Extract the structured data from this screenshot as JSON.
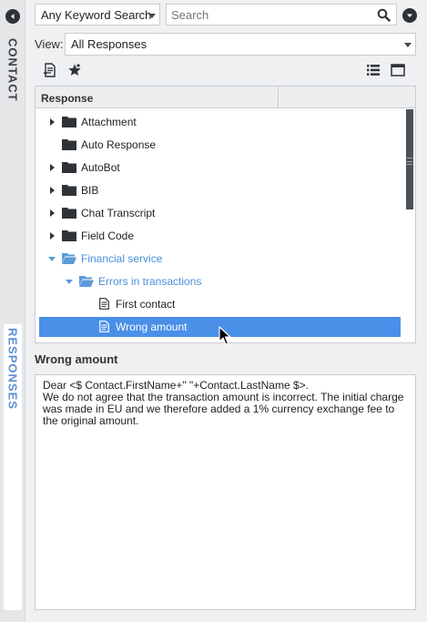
{
  "sidebar": {
    "contact_tab": "CONTACT",
    "responses_tab": "RESPONSES"
  },
  "search": {
    "mode_label": "Any Keyword Search",
    "placeholder": "Search",
    "value": ""
  },
  "view": {
    "label": "View:",
    "selected": "All Responses"
  },
  "tree": {
    "column_header": "Response",
    "items": [
      {
        "label": "Attachment",
        "type": "folder",
        "expanded": false
      },
      {
        "label": "Auto Response",
        "type": "folder",
        "expanded": false
      },
      {
        "label": "AutoBot",
        "type": "folder",
        "expanded": false
      },
      {
        "label": "BIB",
        "type": "folder",
        "expanded": false
      },
      {
        "label": "Chat Transcript",
        "type": "folder",
        "expanded": false
      },
      {
        "label": "Field Code",
        "type": "folder",
        "expanded": false
      },
      {
        "label": "Financial service",
        "type": "folder",
        "expanded": true
      },
      {
        "label": "Errors in transactions",
        "type": "folder",
        "expanded": true
      },
      {
        "label": "First contact",
        "type": "document",
        "expanded": false
      },
      {
        "label": "Wrong amount",
        "type": "document",
        "expanded": false,
        "selected": true
      }
    ]
  },
  "detail": {
    "title": "Wrong amount",
    "line1": "Dear <$ Contact.FirstName+\" \"+Contact.LastName $>.",
    "line2": "We do not agree that the transaction amount is incorrect. The initial charge was made in EU and we therefore added a 1% currency exchange fee to the original amount."
  },
  "colors": {
    "accent": "#4a8fe8",
    "expanded_text": "#4a8fd8",
    "dark_icon": "#2f3338"
  }
}
